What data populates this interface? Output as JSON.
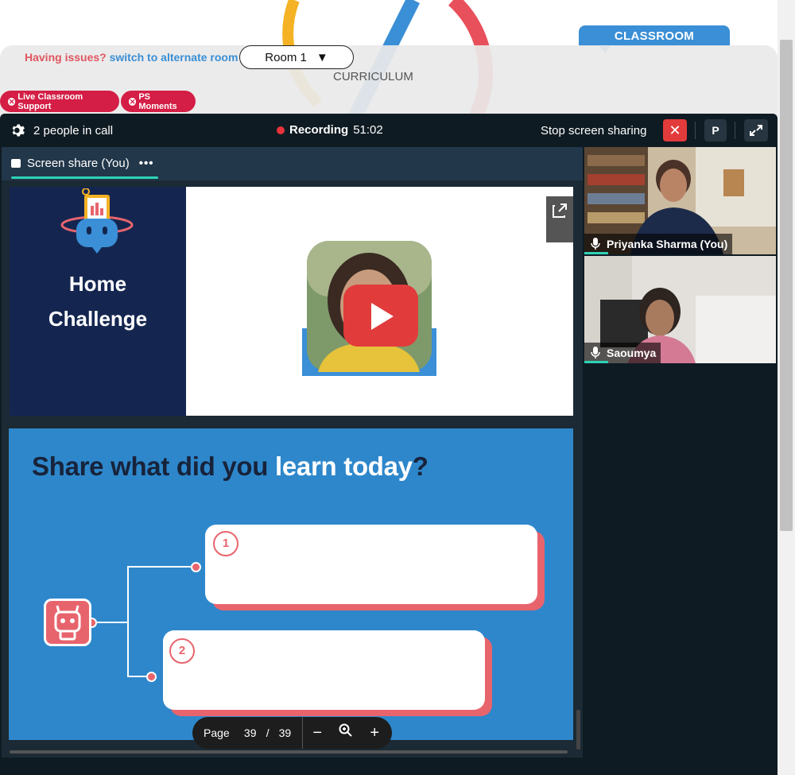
{
  "header": {
    "classroom_tab": "CLASSROOM",
    "issues_text": "Having issues?",
    "switch_link": "switch to alternate room",
    "room_select": "Room 1",
    "curriculum": "CURRICULUM"
  },
  "pills": {
    "support": "Live Classroom Support",
    "moments": "PS Moments"
  },
  "call": {
    "people": "2 people in call",
    "recording_label": "Recording",
    "recording_time": "51:02",
    "stop_sharing": "Stop screen sharing",
    "p_button": "P",
    "share_tab": "Screen share (You)"
  },
  "slide": {
    "home_line1": "Home",
    "home_line2": "Challenge",
    "question_dark1": "Share what did you ",
    "question_white": "learn today",
    "question_dark2": "?",
    "num1": "1",
    "num2": "2"
  },
  "pager": {
    "page_label": "Page",
    "current": "39",
    "slash": "/",
    "total": "39"
  },
  "participants": [
    {
      "name": "Priyanka Sharma (You)"
    },
    {
      "name": "Saoumya"
    }
  ],
  "colors": {
    "accent_red": "#d41e45",
    "accent_blue": "#3a8fd6",
    "call_bg": "#0f1b22",
    "slide_blue": "#2e87cb",
    "coral": "#e8646d"
  }
}
